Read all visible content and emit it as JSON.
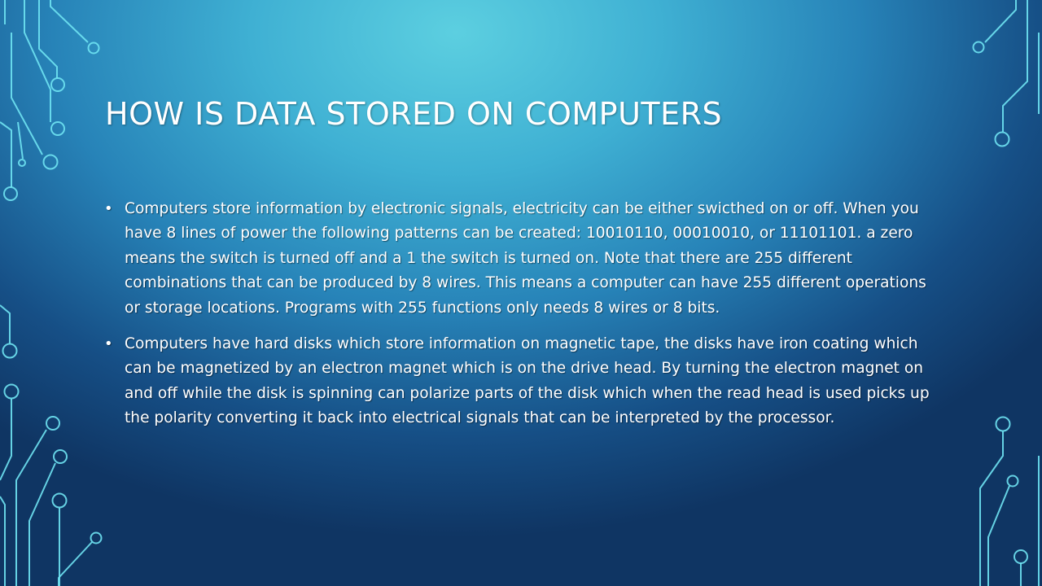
{
  "slide": {
    "title": "HOW IS DATA STORED ON COMPUTERS",
    "bullets": [
      "Computers store information by electronic signals, electricity can be either swicthed on or off. When you have 8 lines of power the following patterns can be created: 10010110, 00010010, or 11101101. a zero means the switch is turned off and a 1 the switch is turned on. Note that there are 255 different combinations that can be produced by 8 wires.  This means a computer can have 255 different operations or storage locations. Programs with 255 functions only needs 8 wires or 8 bits.",
      "Computers have hard disks which store information on magnetic tape, the disks have iron coating which can be magnetized by an electron magnet which is on the drive head. By turning the electron magnet on and off  while the disk is spinning can polarize parts of the disk which when the read head is used picks up the polarity converting it back into electrical signals that can be interpreted by the processor."
    ],
    "bullet_glyph": "•"
  },
  "colors": {
    "background_light": "#5ccfe0",
    "background_dark": "#0f3563",
    "circuit_line": "#6fe3f2",
    "text": "#ffffff"
  },
  "decorations": {
    "left_top": "circuit-lines-decoration",
    "left_bottom": "circuit-lines-decoration",
    "right_top": "circuit-lines-decoration",
    "right_bottom": "circuit-lines-decoration"
  }
}
